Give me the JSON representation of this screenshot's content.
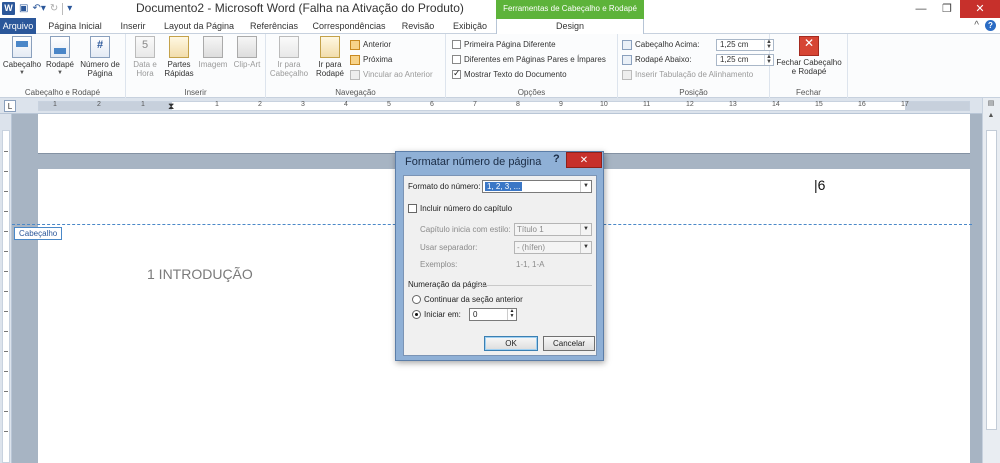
{
  "titlebar": {
    "app_icon": "W",
    "save_icon": "save-icon",
    "undo_icon": "undo-icon",
    "redo_icon": "redo-icon",
    "customize_icon": "customize-icon",
    "document_title": "Documento2 - Microsoft Word (Falha na Ativação do Produto)",
    "context_group": "Ferramentas de Cabeçalho e Rodapé",
    "minimize": "—",
    "maximize": "❐",
    "close": "✕"
  },
  "tabs": {
    "file": "Arquivo",
    "items": [
      "Página Inicial",
      "Inserir",
      "Layout da Página",
      "Referências",
      "Correspondências",
      "Revisão",
      "Exibição"
    ],
    "design": "Design",
    "collapse_icon": "^",
    "help_icon": "?"
  },
  "ribbon": {
    "group1": {
      "label": "Cabeçalho e Rodapé",
      "header": "Cabeçalho",
      "footer": "Rodapé",
      "page_number_1": "Número de",
      "page_number_2": "Página"
    },
    "group2": {
      "label": "Inserir",
      "date_1": "Data e",
      "date_2": "Hora",
      "quick_parts_1": "Partes",
      "quick_parts_2": "Rápidas",
      "image": "Imagem",
      "clipart": "Clip-Art"
    },
    "group3": {
      "label": "Navegação",
      "go_header_1": "Ir para",
      "go_header_2": "Cabeçalho",
      "go_footer_1": "Ir para",
      "go_footer_2": "Rodapé",
      "previous": "Anterior",
      "next": "Próxima",
      "link_previous": "Vincular ao Anterior"
    },
    "group4": {
      "label": "Opções",
      "first_page": "Primeira Página Diferente",
      "odd_even": "Diferentes em Páginas Pares e Ímpares",
      "show_text": "Mostrar Texto do Documento"
    },
    "group5": {
      "label": "Posição",
      "header_top": "Cabeçalho Acima:",
      "header_top_value": "1,25 cm",
      "footer_bottom": "Rodapé Abaixo:",
      "footer_bottom_value": "1,25 cm",
      "align_tab": "Inserir Tabulação de Alinhamento"
    },
    "group6": {
      "label": "Fechar",
      "close_1": "Fechar Cabeçalho",
      "close_2": "e Rodapé"
    }
  },
  "ruler": {
    "tab_selector": "L",
    "left_numbers": [
      "1",
      "2",
      "1"
    ],
    "numbers": [
      "1",
      "2",
      "3",
      "4",
      "5",
      "6",
      "7",
      "8",
      "9",
      "10",
      "11",
      "12",
      "13",
      "14",
      "15",
      "16",
      "17"
    ]
  },
  "document": {
    "header_tag": "Cabeçalho",
    "heading": "1 INTRODUÇÃO",
    "cursor_glyph": "|6"
  },
  "dialog": {
    "title": "Formatar número de página",
    "help": "?",
    "close": "✕",
    "number_format_label": "Formato do número:",
    "number_format_value": "1, 2, 3, ...",
    "include_chapter": "Incluir número do capítulo",
    "chapter_style_label": "Capítulo inicia com estilo:",
    "chapter_style_value": "Título 1",
    "separator_label": "Usar separador:",
    "separator_value": "-   (hífen)",
    "examples_label": "Exemplos:",
    "examples_value": "1-1, 1-A",
    "numbering_section": "Numeração da página",
    "continue_label": "Continuar da seção anterior",
    "start_at_label": "Iniciar em:",
    "start_at_value": "0",
    "ok": "OK",
    "cancel": "Cancelar"
  }
}
